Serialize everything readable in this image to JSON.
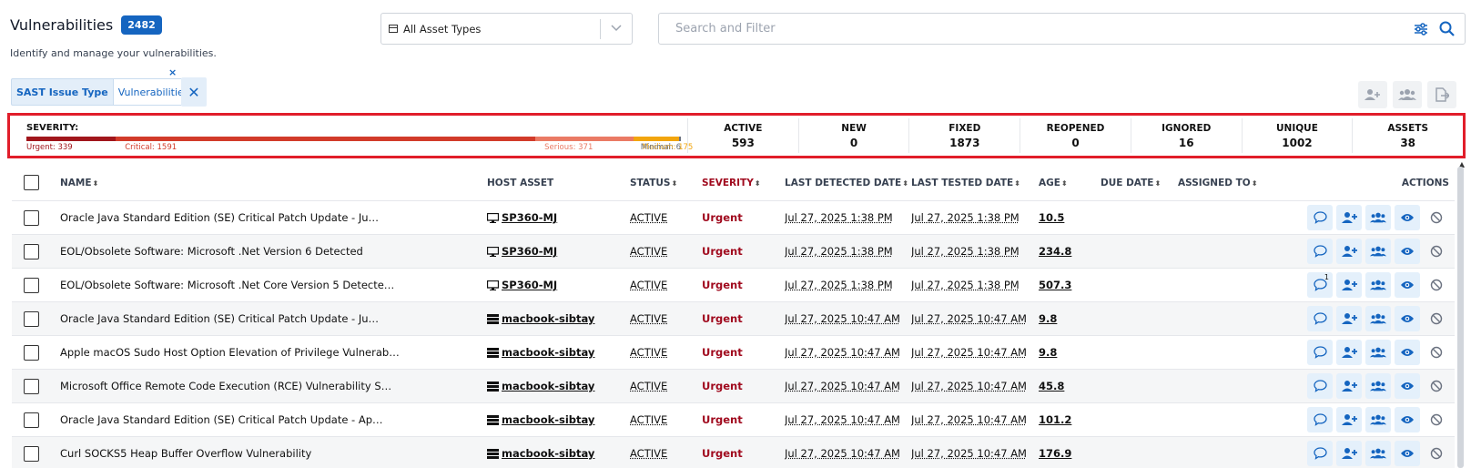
{
  "header": {
    "title": "Vulnerabilities",
    "count": "2482",
    "subtitle": "Identify and manage your vulnerabilities."
  },
  "asset_select": {
    "value": "All Asset Types"
  },
  "search": {
    "placeholder": "Search and Filter",
    "value": ""
  },
  "filter_chip": {
    "key": "SAST Issue Type",
    "value": "Vulnerabilities",
    "close": "×",
    "clear": "✕"
  },
  "severity": {
    "label": "SEVERITY:",
    "segments": [
      {
        "name": "Urgent",
        "label": "Urgent: 339",
        "count": 339,
        "color": "#a1161c"
      },
      {
        "name": "Critical",
        "label": "Critical: 1591",
        "count": 1591,
        "color": "#d23b2a"
      },
      {
        "name": "Serious",
        "label": "Serious: 371",
        "count": 371,
        "color": "#ea7a64"
      },
      {
        "name": "Medium",
        "label": "Medium: 175",
        "count": 175,
        "color": "#f2a50d"
      },
      {
        "name": "Minimal",
        "label": "Minimal: 6",
        "count": 6,
        "color": "#6b7280"
      }
    ]
  },
  "stats": [
    {
      "label": "ACTIVE",
      "value": "593"
    },
    {
      "label": "NEW",
      "value": "0"
    },
    {
      "label": "FIXED",
      "value": "1873"
    },
    {
      "label": "REOPENED",
      "value": "0"
    },
    {
      "label": "IGNORED",
      "value": "16"
    },
    {
      "label": "UNIQUE",
      "value": "1002"
    },
    {
      "label": "ASSETS",
      "value": "38"
    }
  ],
  "columns": {
    "name": "NAME",
    "host": "HOST ASSET",
    "status": "STATUS",
    "severity": "SEVERITY",
    "last_detected": "LAST DETECTED DATE",
    "last_tested": "LAST TESTED DATE",
    "age": "AGE",
    "due": "DUE DATE",
    "assigned": "ASSIGNED TO",
    "actions": "ACTIONS",
    "sort_glyph": "⬍"
  },
  "rows": [
    {
      "name": "Oracle Java Standard Edition (SE) Critical Patch Update - Ju…",
      "host": "SP360-MJ",
      "host_type": "desktop",
      "status": "ACTIVE",
      "severity": "Urgent",
      "last_detected": "Jul 27, 2025 1:38 PM",
      "last_tested": "Jul 27, 2025 1:38 PM",
      "age": "10.5",
      "comments": ""
    },
    {
      "name": "EOL/Obsolete Software: Microsoft .Net Version 6 Detected",
      "host": "SP360-MJ",
      "host_type": "desktop",
      "status": "ACTIVE",
      "severity": "Urgent",
      "last_detected": "Jul 27, 2025 1:38 PM",
      "last_tested": "Jul 27, 2025 1:38 PM",
      "age": "234.8",
      "comments": ""
    },
    {
      "name": "EOL/Obsolete Software: Microsoft .Net Core Version 5 Detecte…",
      "host": "SP360-MJ",
      "host_type": "desktop",
      "status": "ACTIVE",
      "severity": "Urgent",
      "last_detected": "Jul 27, 2025 1:38 PM",
      "last_tested": "Jul 27, 2025 1:38 PM",
      "age": "507.3",
      "comments": "1"
    },
    {
      "name": "Oracle Java Standard Edition (SE) Critical Patch Update - Ju…",
      "host": "macbook-sibtay",
      "host_type": "server",
      "status": "ACTIVE",
      "severity": "Urgent",
      "last_detected": "Jul 27, 2025 10:47 AM",
      "last_tested": "Jul 27, 2025 10:47 AM",
      "age": "9.8",
      "comments": ""
    },
    {
      "name": "Apple macOS Sudo Host Option Elevation of Privilege Vulnerab…",
      "host": "macbook-sibtay",
      "host_type": "server",
      "status": "ACTIVE",
      "severity": "Urgent",
      "last_detected": "Jul 27, 2025 10:47 AM",
      "last_tested": "Jul 27, 2025 10:47 AM",
      "age": "9.8",
      "comments": ""
    },
    {
      "name": "Microsoft Office Remote Code Execution (RCE) Vulnerability S…",
      "host": "macbook-sibtay",
      "host_type": "server",
      "status": "ACTIVE",
      "severity": "Urgent",
      "last_detected": "Jul 27, 2025 10:47 AM",
      "last_tested": "Jul 27, 2025 10:47 AM",
      "age": "45.8",
      "comments": ""
    },
    {
      "name": "Oracle Java Standard Edition (SE) Critical Patch Update - Ap…",
      "host": "macbook-sibtay",
      "host_type": "server",
      "status": "ACTIVE",
      "severity": "Urgent",
      "last_detected": "Jul 27, 2025 10:47 AM",
      "last_tested": "Jul 27, 2025 10:47 AM",
      "age": "101.2",
      "comments": ""
    },
    {
      "name": "Curl SOCKS5 Heap Buffer Overflow Vulnerability",
      "host": "macbook-sibtay",
      "host_type": "server",
      "status": "ACTIVE",
      "severity": "Urgent",
      "last_detected": "Jul 27, 2025 10:47 AM",
      "last_tested": "Jul 27, 2025 10:47 AM",
      "age": "176.9",
      "comments": ""
    }
  ],
  "colors": {
    "accent": "#1565c0",
    "urgent": "#a00a1e",
    "highlight_border": "#e11d2a"
  }
}
